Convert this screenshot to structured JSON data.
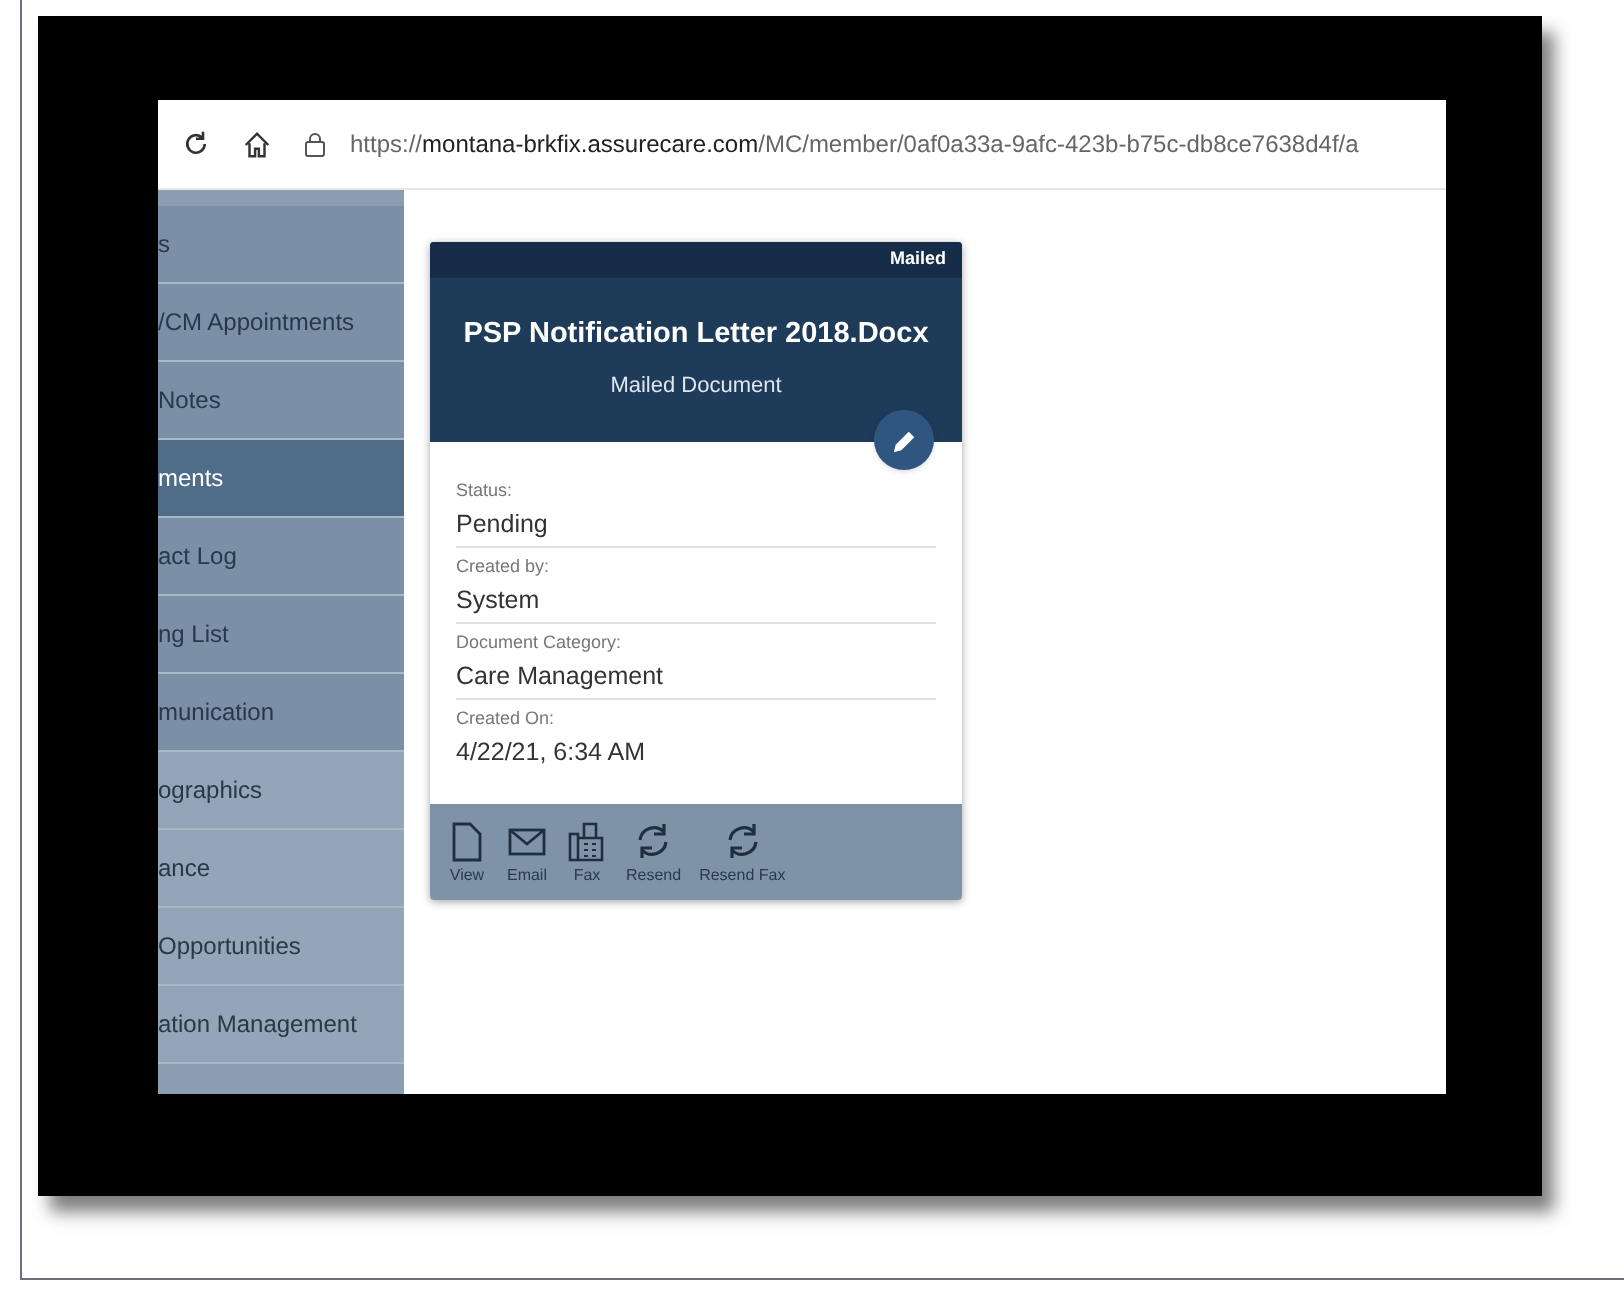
{
  "address_bar": {
    "scheme": "https://",
    "host": "montana-brkfix.assurecare.com",
    "path": "/MC/member/0af0a33a-9afc-423b-b75c-db8ce7638d4f/a"
  },
  "sidebar": {
    "items": [
      {
        "label": "s",
        "selected": false,
        "color": "#7b90a6"
      },
      {
        "label": "/CM Appointments",
        "selected": false,
        "color": "#7b90a6"
      },
      {
        "label": "Notes",
        "selected": false,
        "color": "#7b90a6"
      },
      {
        "label": "ments",
        "selected": true,
        "color": "#4f6c89"
      },
      {
        "label": "act Log",
        "selected": false,
        "color": "#7b90a6"
      },
      {
        "label": "ng List",
        "selected": false,
        "color": "#7b90a6"
      },
      {
        "label": "munication",
        "selected": false,
        "color": "#7b90a6"
      },
      {
        "label": "ographics",
        "selected": false,
        "color": "#93a5b8"
      },
      {
        "label": "ance",
        "selected": false,
        "color": "#93a5b8"
      },
      {
        "label": "Opportunities",
        "selected": false,
        "color": "#93a5b8"
      },
      {
        "label": "ation Management",
        "selected": false,
        "color": "#93a5b8"
      }
    ]
  },
  "card": {
    "badge": "Mailed",
    "title": "PSP Notification Letter 2018.Docx",
    "subtitle": "Mailed Document",
    "fields": [
      {
        "label": "Status:",
        "value": "Pending"
      },
      {
        "label": "Created by:",
        "value": "System"
      },
      {
        "label": "Document Category:",
        "value": "Care Management"
      },
      {
        "label": "Created On:",
        "value": "4/22/21, 6:34 AM"
      }
    ],
    "actions": [
      {
        "kind": "view",
        "label": "View"
      },
      {
        "kind": "email",
        "label": "Email"
      },
      {
        "kind": "fax",
        "label": "Fax"
      },
      {
        "kind": "resend",
        "label": "Resend"
      },
      {
        "kind": "resend",
        "label": "Resend Fax"
      }
    ]
  }
}
